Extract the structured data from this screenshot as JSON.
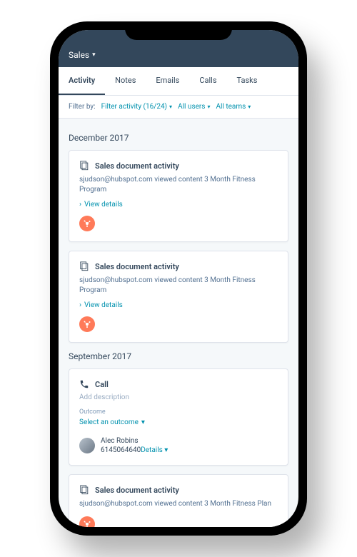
{
  "nav": {
    "section": "Sales"
  },
  "tabs": [
    "Activity",
    "Notes",
    "Emails",
    "Calls",
    "Tasks"
  ],
  "activeTabIndex": 0,
  "filter": {
    "label": "Filter by:",
    "activity": "Filter activity (16/24)",
    "users": "All users",
    "teams": "All teams"
  },
  "groups": [
    {
      "title": "December 2017",
      "items": [
        {
          "type": "doc",
          "title": "Sales document activity",
          "desc": "sjudson@hubspot.com viewed content 3 Month Fitness Program",
          "view": "View details"
        },
        {
          "type": "doc",
          "title": "Sales document activity",
          "desc": "sjudson@hubspot.com viewed content 3 Month Fitness Program",
          "view": "View details"
        }
      ]
    },
    {
      "title": "September 2017",
      "items": [
        {
          "type": "call",
          "title": "Call",
          "descPlaceholder": "Add description",
          "outcomeLabel": "Outcome",
          "outcomeSelect": "Select an outcome",
          "person": {
            "name": "Alec Robins",
            "phone": "6145064640",
            "details": "Details"
          }
        },
        {
          "type": "doc",
          "title": "Sales document activity",
          "desc": "sjudson@hubspot.com viewed content 3 Month Fitness Plan"
        }
      ]
    }
  ]
}
